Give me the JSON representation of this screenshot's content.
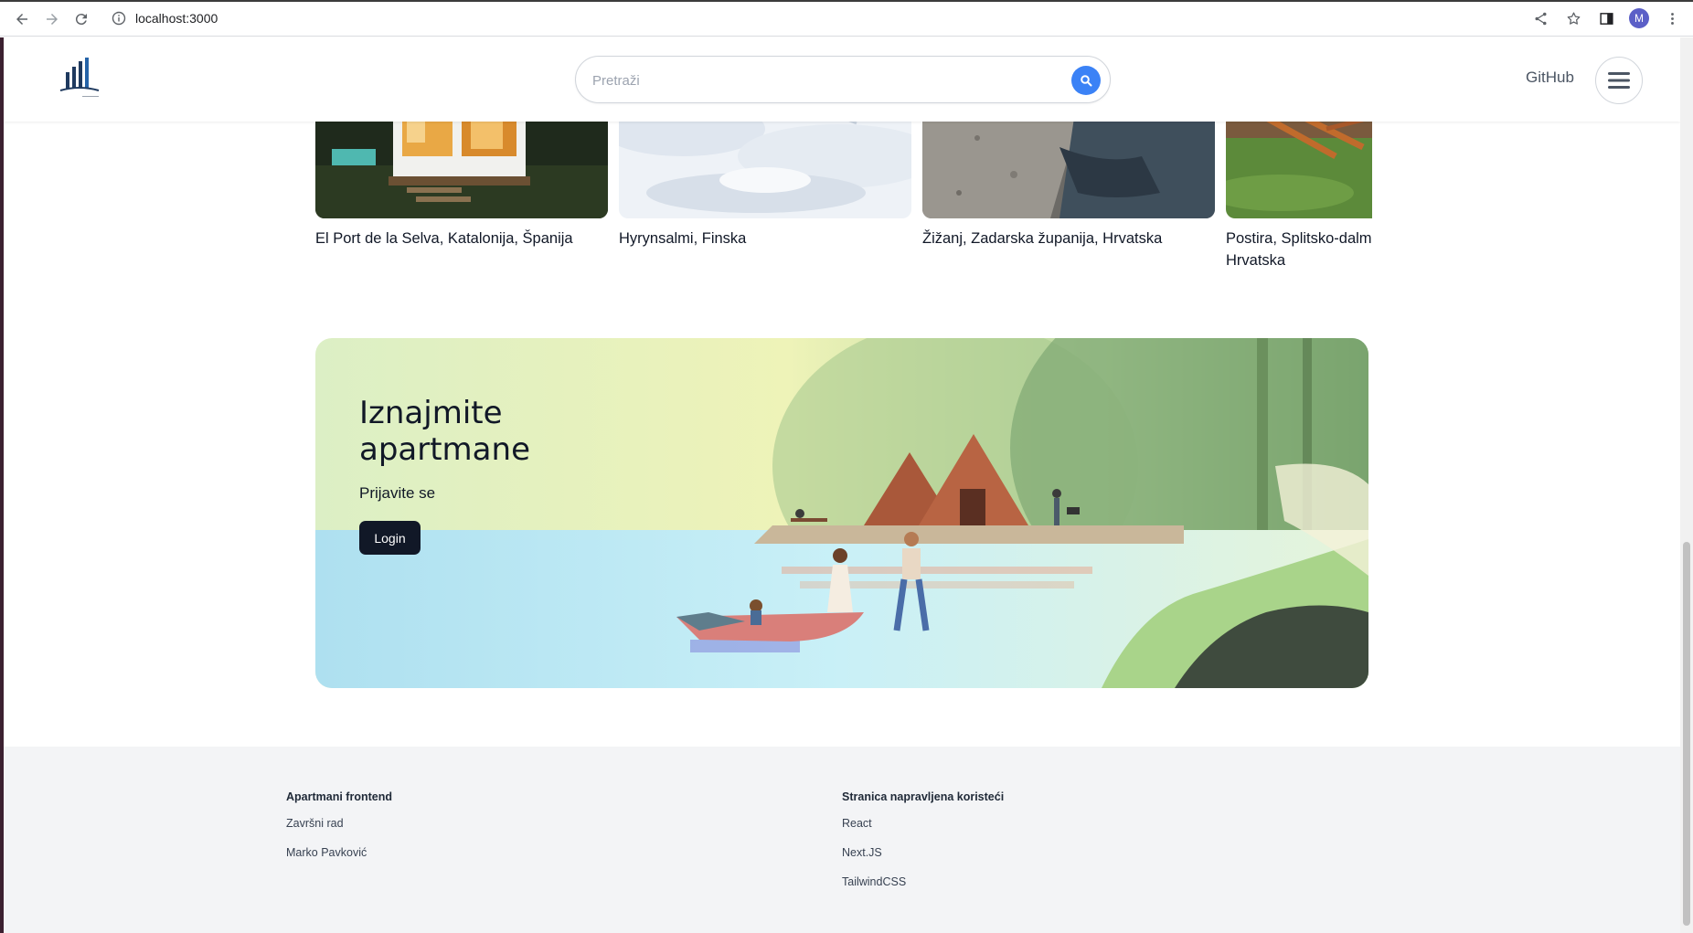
{
  "browser": {
    "url": "localhost:3000",
    "profile_initial": "M"
  },
  "header": {
    "search_placeholder": "Pretraži",
    "github_label": "GitHub"
  },
  "listings": [
    {
      "location": "El Port de la Selva, Katalonija, Španija"
    },
    {
      "location": "Hyrynsalmi, Finska"
    },
    {
      "location": "Žižanj, Zadarska županija, Hrvatska"
    },
    {
      "location_line1": "Postira, Splitsko-dalm",
      "location_line2": "Hrvatska"
    }
  ],
  "hero": {
    "title_line1": "Iznajmite",
    "title_line2": "apartmane",
    "subtitle": "Prijavite se",
    "button": "Login"
  },
  "footer": {
    "col1": {
      "heading": "Apartmani frontend",
      "links": [
        "Završni rad",
        "Marko Pavković"
      ]
    },
    "col2": {
      "heading": "Stranica napravljena koristeći",
      "links": [
        "React",
        "Next.JS",
        "TailwindCSS"
      ]
    }
  },
  "colors": {
    "search_accent": "#3b82f6",
    "button_dark": "#111827",
    "footer_bg": "#f3f4f6"
  }
}
